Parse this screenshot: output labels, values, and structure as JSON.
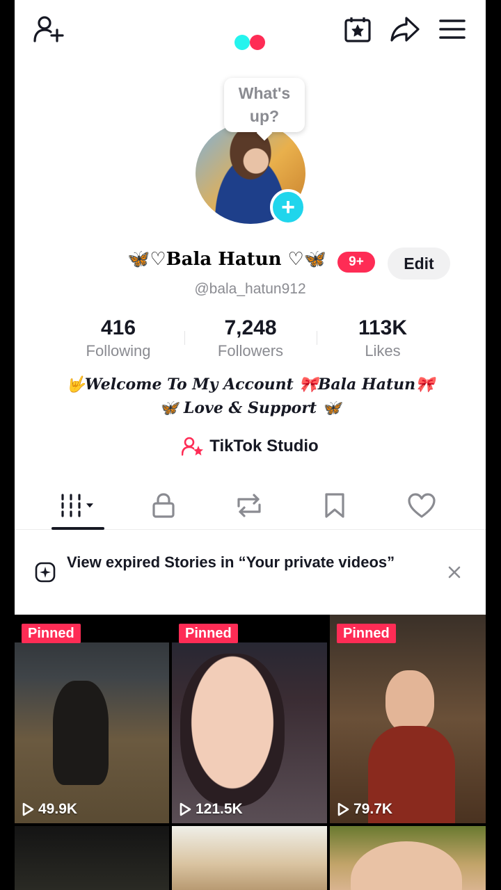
{
  "header": {
    "add_friend_icon": "person-plus-icon",
    "calendar_icon": "calendar-star-icon",
    "share_icon": "share-arrow-icon",
    "menu_icon": "hamburger-menu-icon",
    "logo_colors": [
      "#25F4EE",
      "#FE2C55"
    ]
  },
  "profile": {
    "bubble_text": "What's up?",
    "display_name": "🦋♡Bala Hatun ♡🦋",
    "notification_badge": "9+",
    "edit_label": "Edit",
    "username": "@bala_hatun912"
  },
  "stats": [
    {
      "value": "416",
      "label": "Following"
    },
    {
      "value": "7,248",
      "label": "Followers"
    },
    {
      "value": "113K",
      "label": "Likes"
    }
  ],
  "bio": {
    "line1": "🤟Welcome To My Account 🎀Bala Hatun🎀",
    "line2": "🦋 Love & Support 🦋"
  },
  "studio": {
    "label": "TikTok Studio"
  },
  "tabs": [
    {
      "icon": "grid-icon",
      "active": true
    },
    {
      "icon": "lock-icon",
      "active": false
    },
    {
      "icon": "repost-icon",
      "active": false
    },
    {
      "icon": "bookmark-icon",
      "active": false
    },
    {
      "icon": "heart-icon",
      "active": false
    }
  ],
  "banner": {
    "text": "View expired Stories in “Your private videos”"
  },
  "videos": [
    {
      "pinned_label": "Pinned",
      "views": "49.9K"
    },
    {
      "pinned_label": "Pinned",
      "views": "121.5K"
    },
    {
      "pinned_label": "Pinned",
      "views": "79.7K"
    }
  ],
  "accent_color": "#FE2C55"
}
